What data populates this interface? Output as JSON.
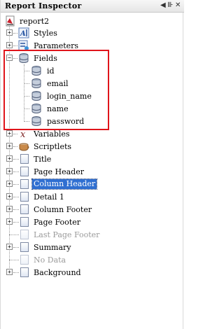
{
  "panel": {
    "title": "Report Inspector",
    "controls": [
      "◀",
      "⊪",
      "✕"
    ]
  },
  "tree": {
    "root": "report2",
    "items": [
      {
        "label": "Styles",
        "icon": "styles-icon"
      },
      {
        "label": "Parameters",
        "icon": "parameters-icon"
      },
      {
        "label": "Fields",
        "icon": "database-icon",
        "children": [
          "id",
          "email",
          "login_name",
          "name",
          "password"
        ]
      },
      {
        "label": "Variables",
        "icon": "variables-icon"
      },
      {
        "label": "Scriptlets",
        "icon": "scriptlets-icon"
      },
      {
        "label": "Title",
        "icon": "band-icon"
      },
      {
        "label": "Page Header",
        "icon": "band-icon"
      },
      {
        "label": "Column Header",
        "icon": "band-icon",
        "selected": true
      },
      {
        "label": "Detail 1",
        "icon": "band-icon"
      },
      {
        "label": "Column Footer",
        "icon": "band-icon"
      },
      {
        "label": "Page Footer",
        "icon": "band-icon"
      },
      {
        "label": "Last Page Footer",
        "icon": "band-icon",
        "disabled": true
      },
      {
        "label": "Summary",
        "icon": "band-icon"
      },
      {
        "label": "No Data",
        "icon": "band-icon",
        "disabled": true
      },
      {
        "label": "Background",
        "icon": "band-icon"
      }
    ]
  },
  "colors": {
    "selection": "#2f6fd1",
    "highlight_border": "#e0141b",
    "disabled_text": "#9a9a9a"
  }
}
